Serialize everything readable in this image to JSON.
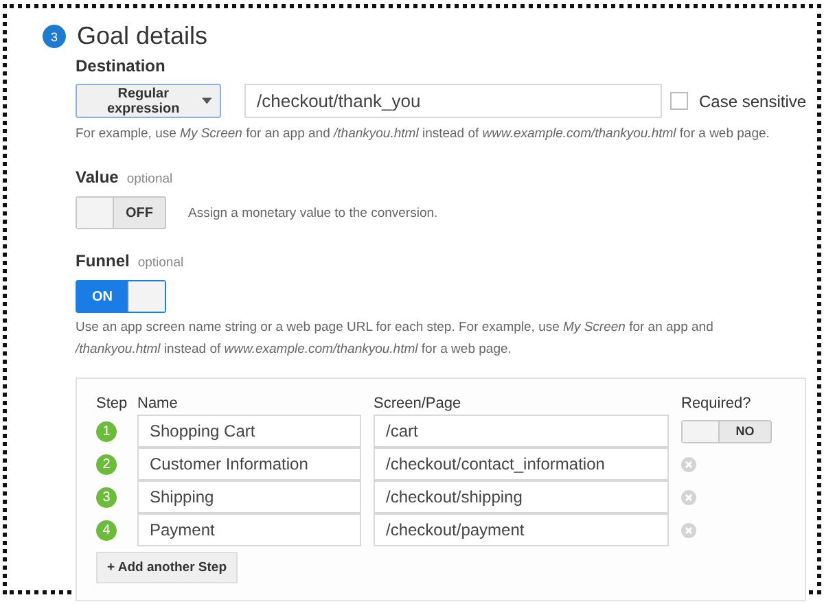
{
  "section": {
    "number": "3",
    "title": "Goal details"
  },
  "destination": {
    "label": "Destination",
    "match_type": "Regular expression",
    "value": "/checkout/thank_you",
    "case_sensitive": {
      "label": "Case sensitive",
      "checked": false
    },
    "hint": "For example, use *My Screen* for an app and */thankyou.html* instead of *www.example.com/thankyou.html* for a web page."
  },
  "value": {
    "label": "Value",
    "optional": "optional",
    "toggle": {
      "label": "OFF",
      "on": false
    },
    "description": "Assign a monetary value to the conversion."
  },
  "funnel": {
    "label": "Funnel",
    "optional": "optional",
    "toggle": {
      "label": "ON",
      "on": true
    },
    "hint": "Use an app screen name string or a web page URL for each step. For example, use *My Screen* for an app and */thankyou.html* instead of *www.example.com/thankyou.html* for a web page."
  },
  "steps": {
    "columns": [
      "Step",
      "Name",
      "Screen/Page",
      "Required?"
    ],
    "rows": [
      {
        "number": "1",
        "name": "Shopping Cart",
        "page": "/cart",
        "kind": "toggle",
        "toggle": {
          "label": "NO",
          "on": false
        }
      },
      {
        "number": "2",
        "name": "Customer Information",
        "page": "/checkout/contact_information",
        "kind": "remove"
      },
      {
        "number": "3",
        "name": "Shipping",
        "page": "/checkout/shipping",
        "kind": "remove"
      },
      {
        "number": "4",
        "name": "Payment",
        "page": "/checkout/payment",
        "kind": "remove"
      }
    ],
    "add_button": "+ Add another Step"
  }
}
